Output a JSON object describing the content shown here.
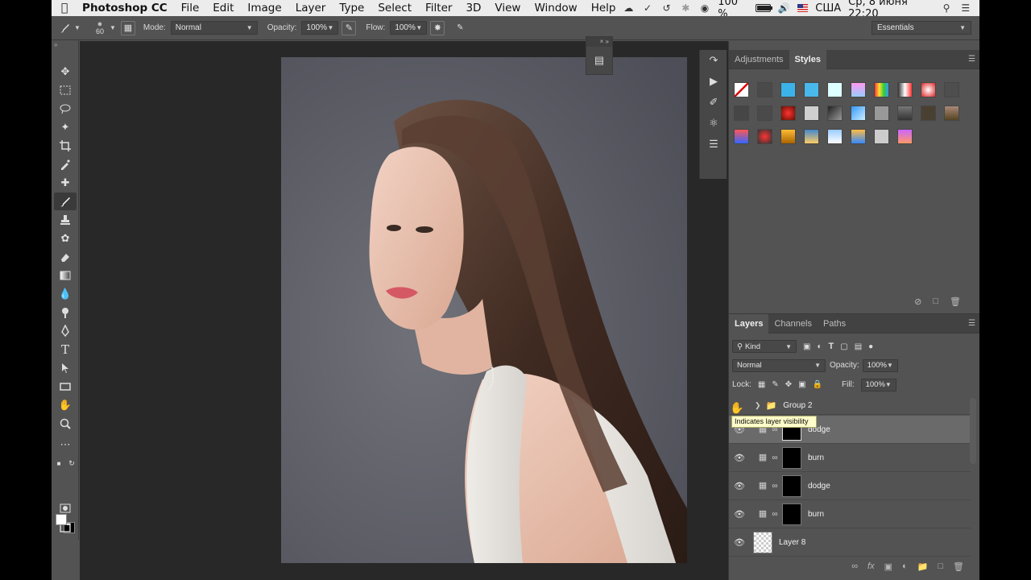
{
  "menubar": {
    "apple_icon": "apple-icon",
    "app_name": "Photoshop CC",
    "menus": [
      "File",
      "Edit",
      "Image",
      "Layer",
      "Type",
      "Select",
      "Filter",
      "3D",
      "View",
      "Window",
      "Help"
    ],
    "battery": "100 %",
    "battery_level": 1.0,
    "input_source": "США",
    "datetime": "Ср, 8 июня  22:20"
  },
  "options": {
    "brush_size": "60",
    "mode_label": "Mode:",
    "mode_value": "Normal",
    "opacity_label": "Opacity:",
    "opacity_value": "100%",
    "flow_label": "Flow:",
    "flow_value": "100%",
    "workspace": "Essentials"
  },
  "styles_panel": {
    "tabs": [
      "Adjustments",
      "Styles"
    ],
    "active_tab": "Styles"
  },
  "layers_panel": {
    "tabs": [
      "Layers",
      "Channels",
      "Paths"
    ],
    "active_tab": "Layers",
    "filter_kind": "Kind",
    "blend_mode": "Normal",
    "opacity_label": "Opacity:",
    "opacity_value": "100%",
    "lock_label": "Lock:",
    "fill_label": "Fill:",
    "fill_value": "100%",
    "group_name": "Group 2",
    "layers": [
      {
        "name": "dodge",
        "selected": true
      },
      {
        "name": "burn",
        "selected": false
      },
      {
        "name": "dodge",
        "selected": false
      },
      {
        "name": "burn",
        "selected": false
      },
      {
        "name": "Layer 8",
        "selected": false
      }
    ],
    "tooltip": "Indicates layer visibility"
  },
  "colors": {
    "foreground": "#ffffff",
    "background": "#000000",
    "ui_panel": "#535353",
    "canvas_bg": "#282828"
  }
}
